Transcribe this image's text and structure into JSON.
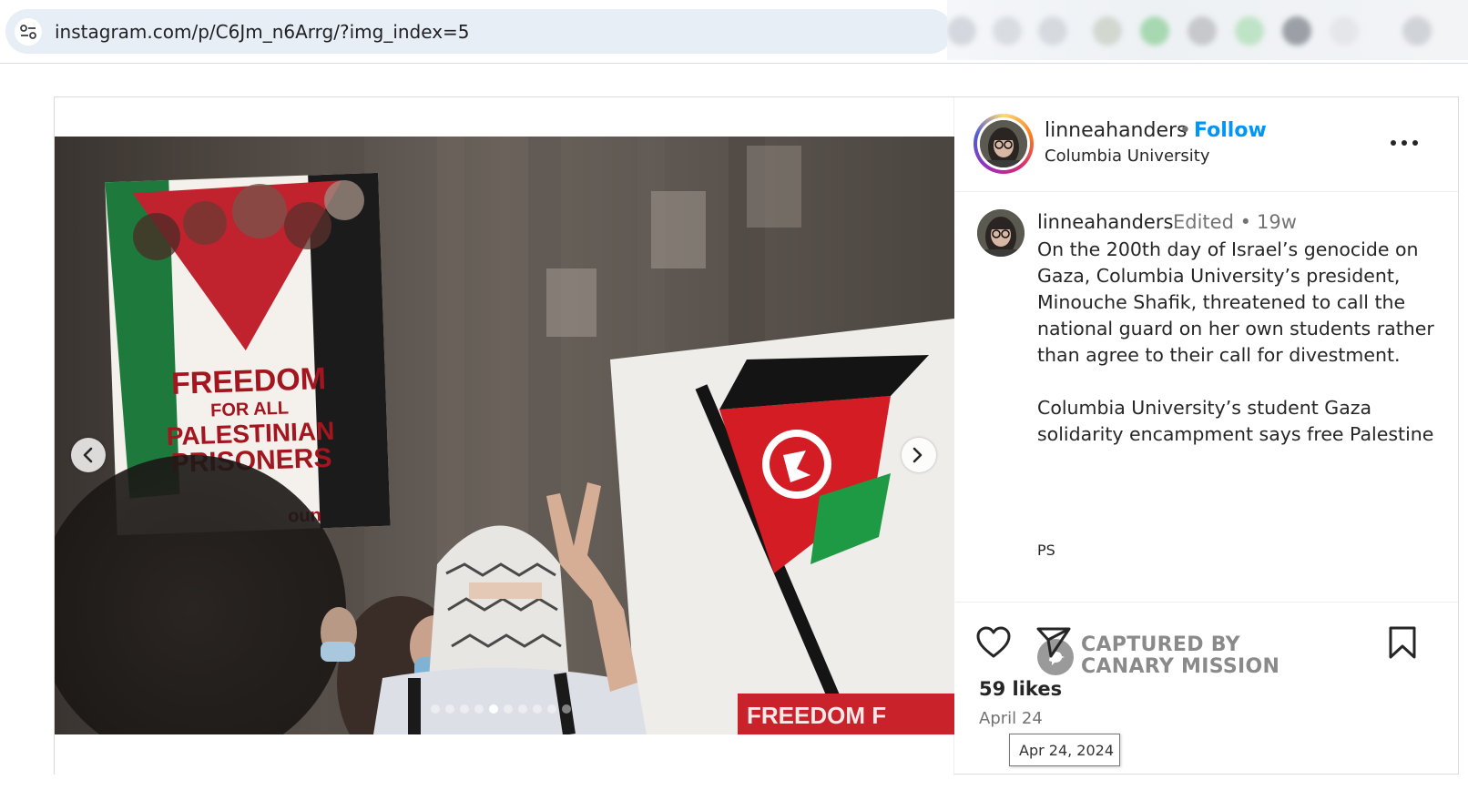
{
  "browser": {
    "url": "instagram.com/p/C6Jm_n6Arrg/?img_index=5",
    "site_info_icon": "tune-icon"
  },
  "post": {
    "header": {
      "username": "linneahanders",
      "separator": "•",
      "follow_label": "Follow",
      "location": "Columbia University"
    },
    "media": {
      "sign_text": [
        "FREEDOM",
        "FOR ALL",
        "PALESTINIAN",
        "PRISONERS"
      ],
      "sign_logo_fragment": "oun",
      "banner_text_fragment": "FREEDOM F",
      "carousel": {
        "total": 10,
        "current": 5
      }
    },
    "caption": {
      "username": "linneahanders",
      "edited": "Edited •",
      "time": "19w",
      "paragraph1": "On the 200th day of Israel’s genocide on Gaza, Columbia University’s president, Minouche Shafik, threatened to call the national guard on her own students rather than agree to their call for divestment.",
      "paragraph2": "Columbia University’s student Gaza solidarity encampment says free Palestine",
      "ps": "PS"
    },
    "watermark": {
      "line1": "CAPTURED BY",
      "line2": "CANARY MISSION"
    },
    "actions": {
      "likes": "59 likes",
      "date": "April 24",
      "date_tooltip": "Apr 24, 2024"
    }
  },
  "colors": {
    "follow_blue": "#0095f6",
    "text_primary": "#262626",
    "text_secondary": "#737373",
    "flag_red": "#c8102e",
    "flag_green": "#1e8e3e"
  }
}
